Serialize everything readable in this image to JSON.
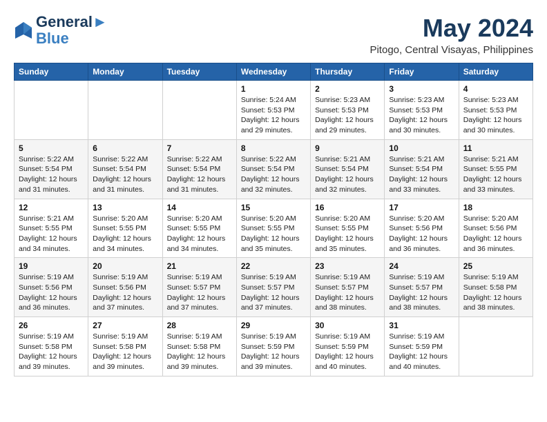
{
  "header": {
    "logo_line1": "General",
    "logo_line2": "Blue",
    "month_title": "May 2024",
    "location": "Pitogo, Central Visayas, Philippines"
  },
  "weekdays": [
    "Sunday",
    "Monday",
    "Tuesday",
    "Wednesday",
    "Thursday",
    "Friday",
    "Saturday"
  ],
  "weeks": [
    [
      {
        "day": "",
        "info": ""
      },
      {
        "day": "",
        "info": ""
      },
      {
        "day": "",
        "info": ""
      },
      {
        "day": "1",
        "info": "Sunrise: 5:24 AM\nSunset: 5:53 PM\nDaylight: 12 hours\nand 29 minutes."
      },
      {
        "day": "2",
        "info": "Sunrise: 5:23 AM\nSunset: 5:53 PM\nDaylight: 12 hours\nand 29 minutes."
      },
      {
        "day": "3",
        "info": "Sunrise: 5:23 AM\nSunset: 5:53 PM\nDaylight: 12 hours\nand 30 minutes."
      },
      {
        "day": "4",
        "info": "Sunrise: 5:23 AM\nSunset: 5:53 PM\nDaylight: 12 hours\nand 30 minutes."
      }
    ],
    [
      {
        "day": "5",
        "info": "Sunrise: 5:22 AM\nSunset: 5:54 PM\nDaylight: 12 hours\nand 31 minutes."
      },
      {
        "day": "6",
        "info": "Sunrise: 5:22 AM\nSunset: 5:54 PM\nDaylight: 12 hours\nand 31 minutes."
      },
      {
        "day": "7",
        "info": "Sunrise: 5:22 AM\nSunset: 5:54 PM\nDaylight: 12 hours\nand 31 minutes."
      },
      {
        "day": "8",
        "info": "Sunrise: 5:22 AM\nSunset: 5:54 PM\nDaylight: 12 hours\nand 32 minutes."
      },
      {
        "day": "9",
        "info": "Sunrise: 5:21 AM\nSunset: 5:54 PM\nDaylight: 12 hours\nand 32 minutes."
      },
      {
        "day": "10",
        "info": "Sunrise: 5:21 AM\nSunset: 5:54 PM\nDaylight: 12 hours\nand 33 minutes."
      },
      {
        "day": "11",
        "info": "Sunrise: 5:21 AM\nSunset: 5:55 PM\nDaylight: 12 hours\nand 33 minutes."
      }
    ],
    [
      {
        "day": "12",
        "info": "Sunrise: 5:21 AM\nSunset: 5:55 PM\nDaylight: 12 hours\nand 34 minutes."
      },
      {
        "day": "13",
        "info": "Sunrise: 5:20 AM\nSunset: 5:55 PM\nDaylight: 12 hours\nand 34 minutes."
      },
      {
        "day": "14",
        "info": "Sunrise: 5:20 AM\nSunset: 5:55 PM\nDaylight: 12 hours\nand 34 minutes."
      },
      {
        "day": "15",
        "info": "Sunrise: 5:20 AM\nSunset: 5:55 PM\nDaylight: 12 hours\nand 35 minutes."
      },
      {
        "day": "16",
        "info": "Sunrise: 5:20 AM\nSunset: 5:55 PM\nDaylight: 12 hours\nand 35 minutes."
      },
      {
        "day": "17",
        "info": "Sunrise: 5:20 AM\nSunset: 5:56 PM\nDaylight: 12 hours\nand 36 minutes."
      },
      {
        "day": "18",
        "info": "Sunrise: 5:20 AM\nSunset: 5:56 PM\nDaylight: 12 hours\nand 36 minutes."
      }
    ],
    [
      {
        "day": "19",
        "info": "Sunrise: 5:19 AM\nSunset: 5:56 PM\nDaylight: 12 hours\nand 36 minutes."
      },
      {
        "day": "20",
        "info": "Sunrise: 5:19 AM\nSunset: 5:56 PM\nDaylight: 12 hours\nand 37 minutes."
      },
      {
        "day": "21",
        "info": "Sunrise: 5:19 AM\nSunset: 5:57 PM\nDaylight: 12 hours\nand 37 minutes."
      },
      {
        "day": "22",
        "info": "Sunrise: 5:19 AM\nSunset: 5:57 PM\nDaylight: 12 hours\nand 37 minutes."
      },
      {
        "day": "23",
        "info": "Sunrise: 5:19 AM\nSunset: 5:57 PM\nDaylight: 12 hours\nand 38 minutes."
      },
      {
        "day": "24",
        "info": "Sunrise: 5:19 AM\nSunset: 5:57 PM\nDaylight: 12 hours\nand 38 minutes."
      },
      {
        "day": "25",
        "info": "Sunrise: 5:19 AM\nSunset: 5:58 PM\nDaylight: 12 hours\nand 38 minutes."
      }
    ],
    [
      {
        "day": "26",
        "info": "Sunrise: 5:19 AM\nSunset: 5:58 PM\nDaylight: 12 hours\nand 39 minutes."
      },
      {
        "day": "27",
        "info": "Sunrise: 5:19 AM\nSunset: 5:58 PM\nDaylight: 12 hours\nand 39 minutes."
      },
      {
        "day": "28",
        "info": "Sunrise: 5:19 AM\nSunset: 5:58 PM\nDaylight: 12 hours\nand 39 minutes."
      },
      {
        "day": "29",
        "info": "Sunrise: 5:19 AM\nSunset: 5:59 PM\nDaylight: 12 hours\nand 39 minutes."
      },
      {
        "day": "30",
        "info": "Sunrise: 5:19 AM\nSunset: 5:59 PM\nDaylight: 12 hours\nand 40 minutes."
      },
      {
        "day": "31",
        "info": "Sunrise: 5:19 AM\nSunset: 5:59 PM\nDaylight: 12 hours\nand 40 minutes."
      },
      {
        "day": "",
        "info": ""
      }
    ]
  ]
}
